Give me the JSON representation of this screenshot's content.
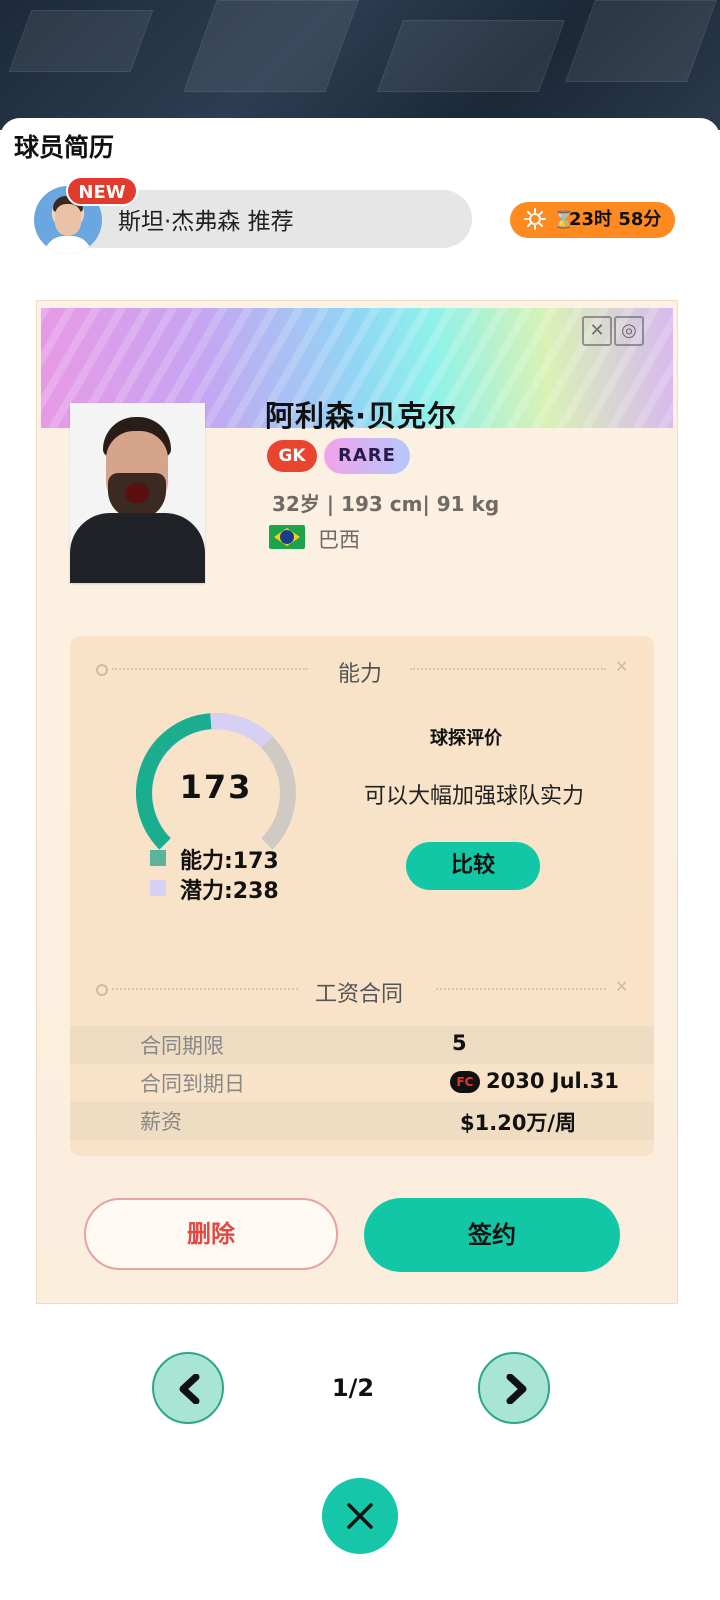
{
  "header": {
    "title": "球员简历"
  },
  "recommendation": {
    "badge": "NEW",
    "text": "斯坦·杰弗森 推荐"
  },
  "timer": {
    "icon": "hourglass-icon",
    "text": "23时 58分"
  },
  "player": {
    "name": "阿利森·贝克尔",
    "position": "GK",
    "rarity": "RARE",
    "meta": "32岁 | 193 cm|  91 kg",
    "country": "巴西"
  },
  "ability": {
    "section_title": "能力",
    "value": 173,
    "potential": 238,
    "ability_label": "能力:173",
    "potential_label": "潜力:238",
    "ability_color": "#1aae8e",
    "potential_color": "#d6d0f5"
  },
  "scout": {
    "title": "球探评价",
    "text": "可以大幅加强球队实力",
    "compare_label": "比较"
  },
  "contract": {
    "section_title": "工资合同",
    "rows": [
      {
        "key": "合同期限",
        "value": "5"
      },
      {
        "key": "合同到期日",
        "value": "2030 Jul.31",
        "icon": "FC"
      },
      {
        "key": "薪资",
        "value": "$1.20万/周"
      }
    ]
  },
  "actions": {
    "delete_label": "删除",
    "sign_label": "签约"
  },
  "pager": {
    "text": "1/2"
  },
  "colors": {
    "accent": "#12c7a6",
    "danger": "#e04a42",
    "timer": "#ff8a1f"
  }
}
